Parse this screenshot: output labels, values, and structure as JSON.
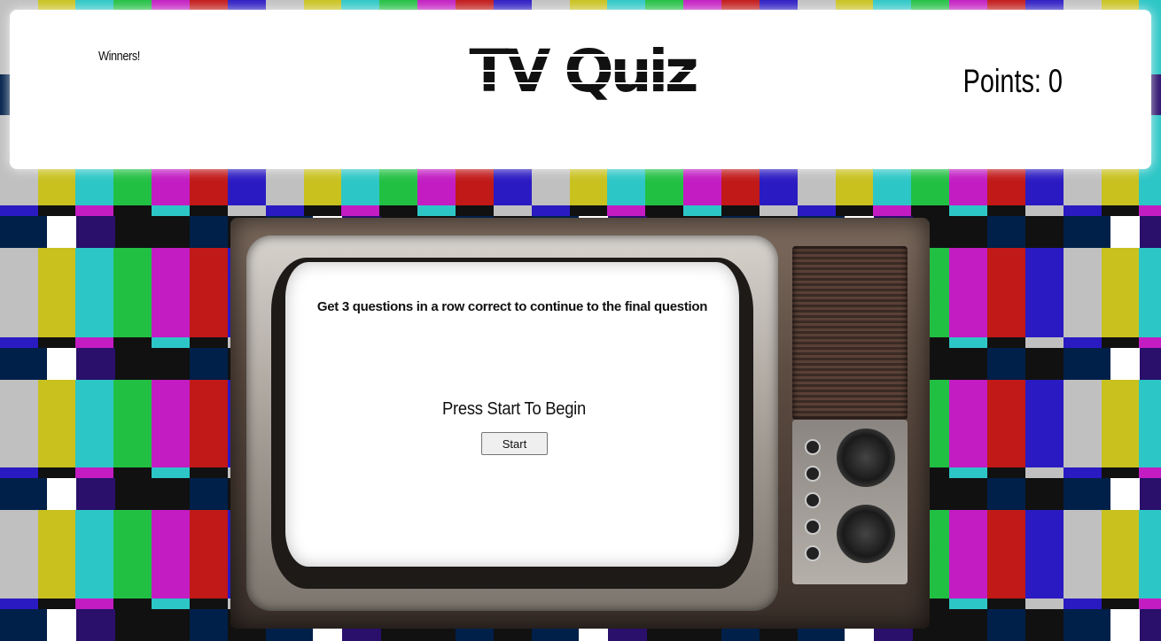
{
  "header": {
    "winners_link": "Winners!",
    "logo_text": "TV Quiz",
    "points_label": "Points: 0"
  },
  "quiz": {
    "rules": "Get 3 questions in a row correct to continue to the final question",
    "prompt": "Press Start To Begin",
    "start_label": "Start"
  },
  "colors": {
    "background": "color-bars",
    "header_bg": "#ffffff",
    "screen_bg": "#ffffff"
  }
}
